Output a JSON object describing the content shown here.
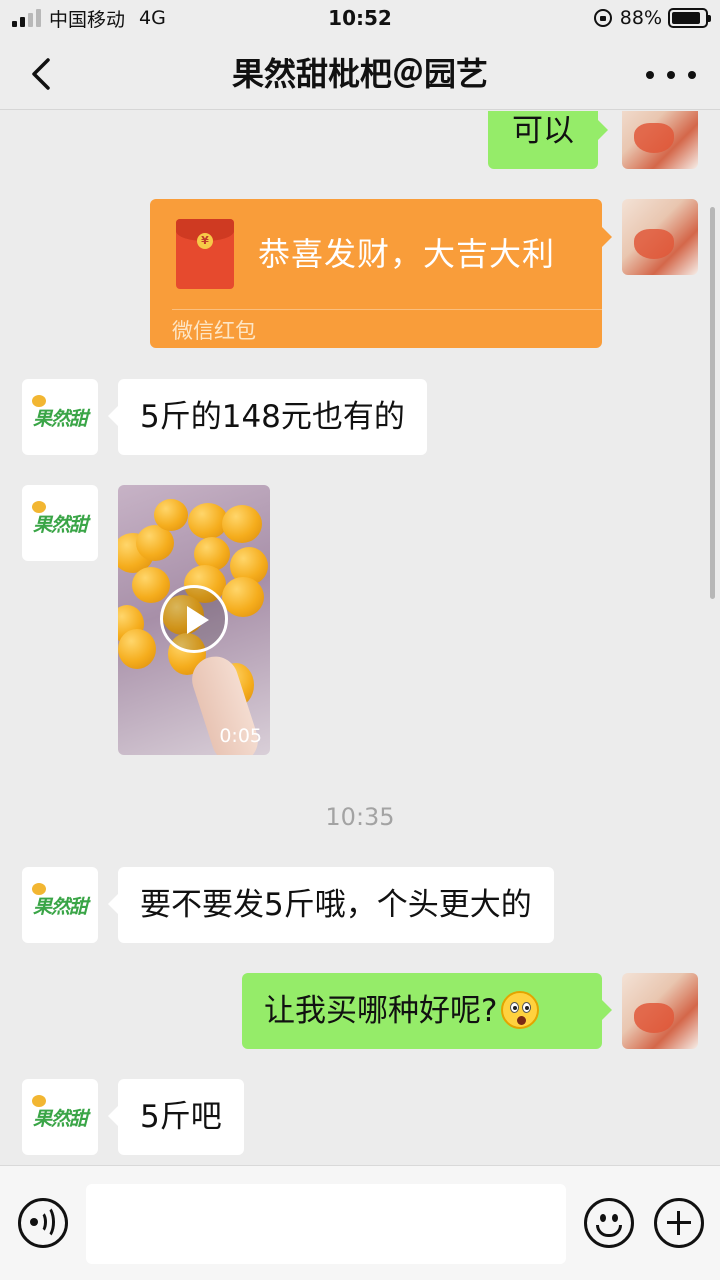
{
  "status_bar": {
    "carrier": "中国移动",
    "network": "4G",
    "time": "10:52",
    "battery_percent": "88%",
    "battery_level": 0.88
  },
  "nav": {
    "title": "果然甜枇杷＠园艺",
    "back_icon": "chevron-left-icon",
    "more_icon": "more-dots-icon"
  },
  "shop_logo_text": "果然甜",
  "messages": [
    {
      "from": "self",
      "type": "text",
      "text": "可以"
    },
    {
      "from": "self",
      "type": "red_packet",
      "text": "恭喜发财，大吉大利",
      "label": "微信红包"
    },
    {
      "from": "shop",
      "type": "text",
      "text": "5斤的148元也有的"
    },
    {
      "from": "shop",
      "type": "video",
      "duration": "0:05"
    },
    {
      "type": "timestamp",
      "text": "10:35"
    },
    {
      "from": "shop",
      "type": "text",
      "text": "要不要发5斤哦，个头更大的"
    },
    {
      "from": "self",
      "type": "text",
      "text": "让我买哪种好呢?",
      "emoji": "surprised-face-emoji"
    },
    {
      "from": "shop",
      "type": "text",
      "text": "5斤吧"
    }
  ],
  "input_bar": {
    "voice_icon": "voice-icon",
    "emoji_icon": "emoji-icon",
    "plus_icon": "plus-icon",
    "text_value": ""
  },
  "colors": {
    "outgoing_bubble": "#95ec69",
    "incoming_bubble": "#ffffff",
    "red_packet": "#f99d3a",
    "background": "#ececec"
  }
}
